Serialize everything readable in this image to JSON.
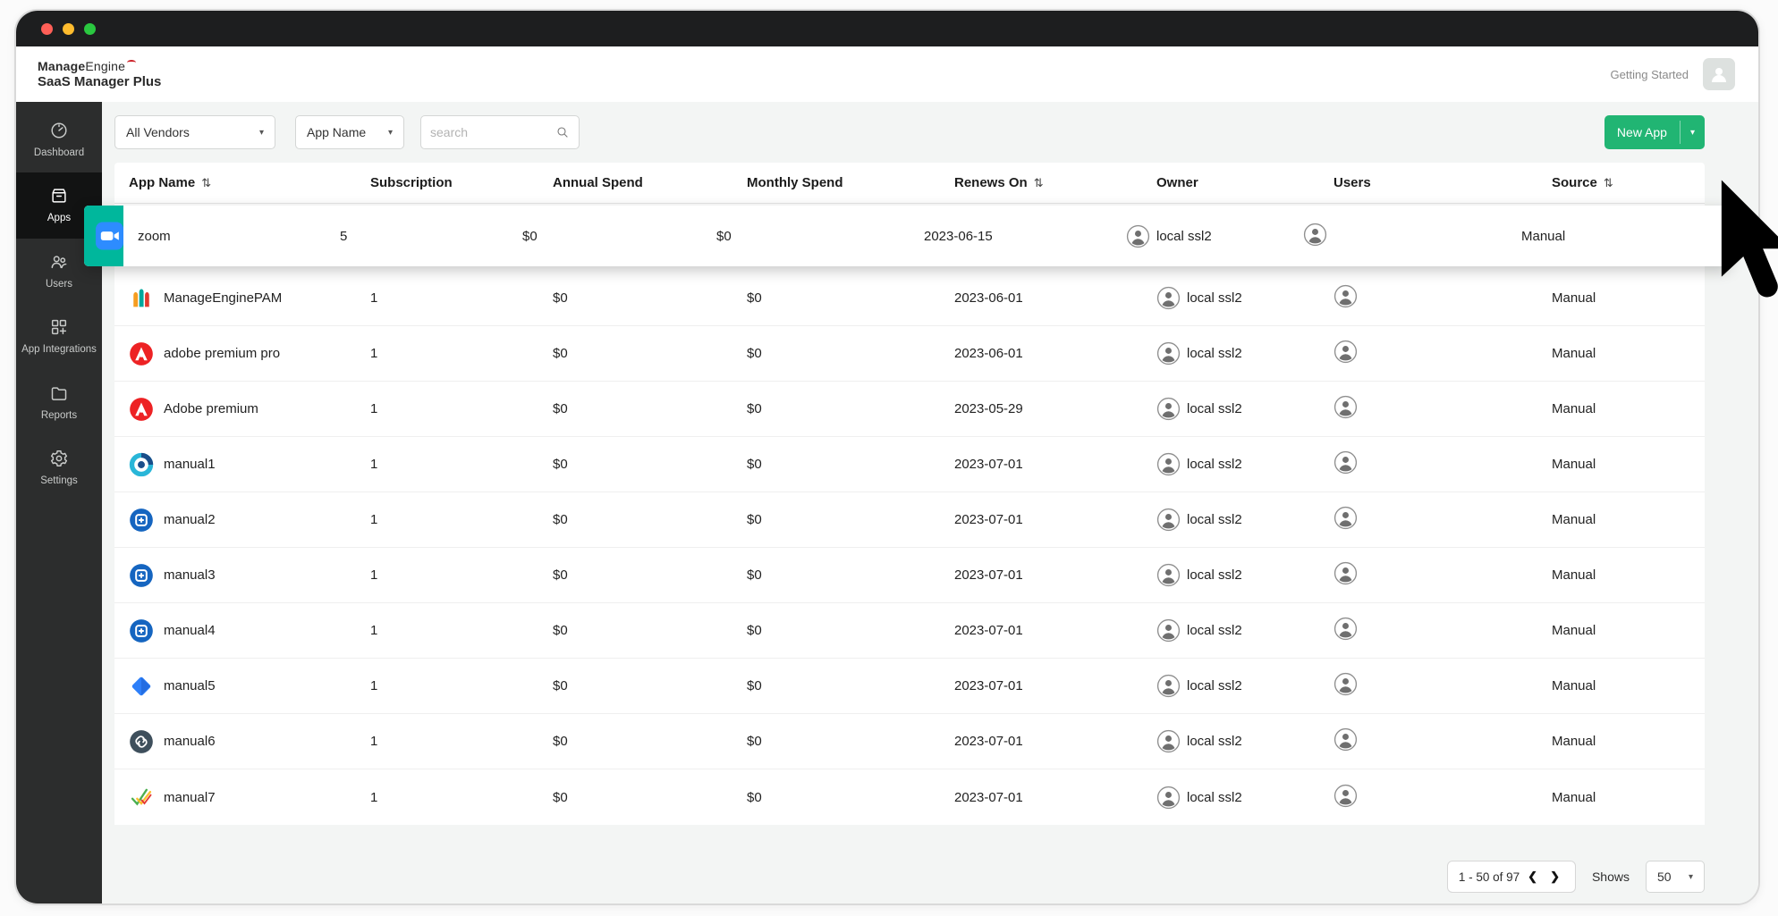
{
  "brand": {
    "name_bold": "Manage",
    "name_rest": "Engine",
    "product": "SaaS Manager Plus"
  },
  "header": {
    "getting_started": "Getting Started"
  },
  "sidebar": {
    "items": [
      {
        "label": "Dashboard",
        "icon": "dashboard-icon",
        "active": false
      },
      {
        "label": "Apps",
        "icon": "apps-icon",
        "active": true
      },
      {
        "label": "Users",
        "icon": "users-icon",
        "active": false
      },
      {
        "label": "App Integrations",
        "icon": "app-integrations-icon",
        "active": false
      },
      {
        "label": "Reports",
        "icon": "reports-icon",
        "active": false
      },
      {
        "label": "Settings",
        "icon": "settings-icon",
        "active": false
      }
    ]
  },
  "toolbar": {
    "vendor_filter": "All Vendors",
    "field_filter": "App Name",
    "search_placeholder": "search",
    "new_app_label": "New App"
  },
  "icons": {
    "sort": "⇅",
    "caret": "▾",
    "chevron_left": "❮",
    "chevron_right": "❯"
  },
  "table": {
    "columns": [
      {
        "label": "App Name",
        "sortable": true
      },
      {
        "label": "Subscription",
        "sortable": false
      },
      {
        "label": "Annual Spend",
        "sortable": false
      },
      {
        "label": "Monthly Spend",
        "sortable": false
      },
      {
        "label": "Renews On",
        "sortable": true
      },
      {
        "label": "Owner",
        "sortable": false
      },
      {
        "label": "Users",
        "sortable": false
      },
      {
        "label": "Source",
        "sortable": true
      }
    ],
    "rows": [
      {
        "app": "zoom",
        "icon": "zoom-app-icon",
        "subscription": "5",
        "annual": "$0",
        "monthly": "$0",
        "renews": "2023-06-15",
        "owner": "local ssl2",
        "source": "Manual",
        "highlighted": true
      },
      {
        "app": "ManageEnginePAM",
        "icon": "manageengine-pam-icon",
        "subscription": "1",
        "annual": "$0",
        "monthly": "$0",
        "renews": "2023-06-01",
        "owner": "local ssl2",
        "source": "Manual",
        "highlighted": false
      },
      {
        "app": "adobe premium pro",
        "icon": "adobe-icon",
        "subscription": "1",
        "annual": "$0",
        "monthly": "$0",
        "renews": "2023-06-01",
        "owner": "local ssl2",
        "source": "Manual",
        "highlighted": false
      },
      {
        "app": "Adobe premium",
        "icon": "adobe-icon",
        "subscription": "1",
        "annual": "$0",
        "monthly": "$0",
        "renews": "2023-05-29",
        "owner": "local ssl2",
        "source": "Manual",
        "highlighted": false
      },
      {
        "app": "manual1",
        "icon": "orbit-app-icon",
        "subscription": "1",
        "annual": "$0",
        "monthly": "$0",
        "renews": "2023-07-01",
        "owner": "local ssl2",
        "source": "Manual",
        "highlighted": false
      },
      {
        "app": "manual2",
        "icon": "blue-app-icon",
        "subscription": "1",
        "annual": "$0",
        "monthly": "$0",
        "renews": "2023-07-01",
        "owner": "local ssl2",
        "source": "Manual",
        "highlighted": false
      },
      {
        "app": "manual3",
        "icon": "blue-app-icon",
        "subscription": "1",
        "annual": "$0",
        "monthly": "$0",
        "renews": "2023-07-01",
        "owner": "local ssl2",
        "source": "Manual",
        "highlighted": false
      },
      {
        "app": "manual4",
        "icon": "blue-app-icon",
        "subscription": "1",
        "annual": "$0",
        "monthly": "$0",
        "renews": "2023-07-01",
        "owner": "local ssl2",
        "source": "Manual",
        "highlighted": false
      },
      {
        "app": "manual5",
        "icon": "diamond-app-icon",
        "subscription": "1",
        "annual": "$0",
        "monthly": "$0",
        "renews": "2023-07-01",
        "owner": "local ssl2",
        "source": "Manual",
        "highlighted": false
      },
      {
        "app": "manual6",
        "icon": "link-app-icon",
        "subscription": "1",
        "annual": "$0",
        "monthly": "$0",
        "renews": "2023-07-01",
        "owner": "local ssl2",
        "source": "Manual",
        "highlighted": false
      },
      {
        "app": "manual7",
        "icon": "checkmarks-app-icon",
        "subscription": "1",
        "annual": "$0",
        "monthly": "$0",
        "renews": "2023-07-01",
        "owner": "local ssl2",
        "source": "Manual",
        "highlighted": false
      }
    ]
  },
  "footer": {
    "range": "1 - 50 of 97",
    "shows_label": "Shows",
    "page_size": "50"
  },
  "colors": {
    "new_app_green": "#21B573",
    "highlight_teal": "#00B79C",
    "zoom_blue": "#2D8CFF",
    "sidebar_bg": "#2C2D2D",
    "titlebar_bg": "#1D1E1F",
    "main_bg": "#F3F5F4"
  }
}
